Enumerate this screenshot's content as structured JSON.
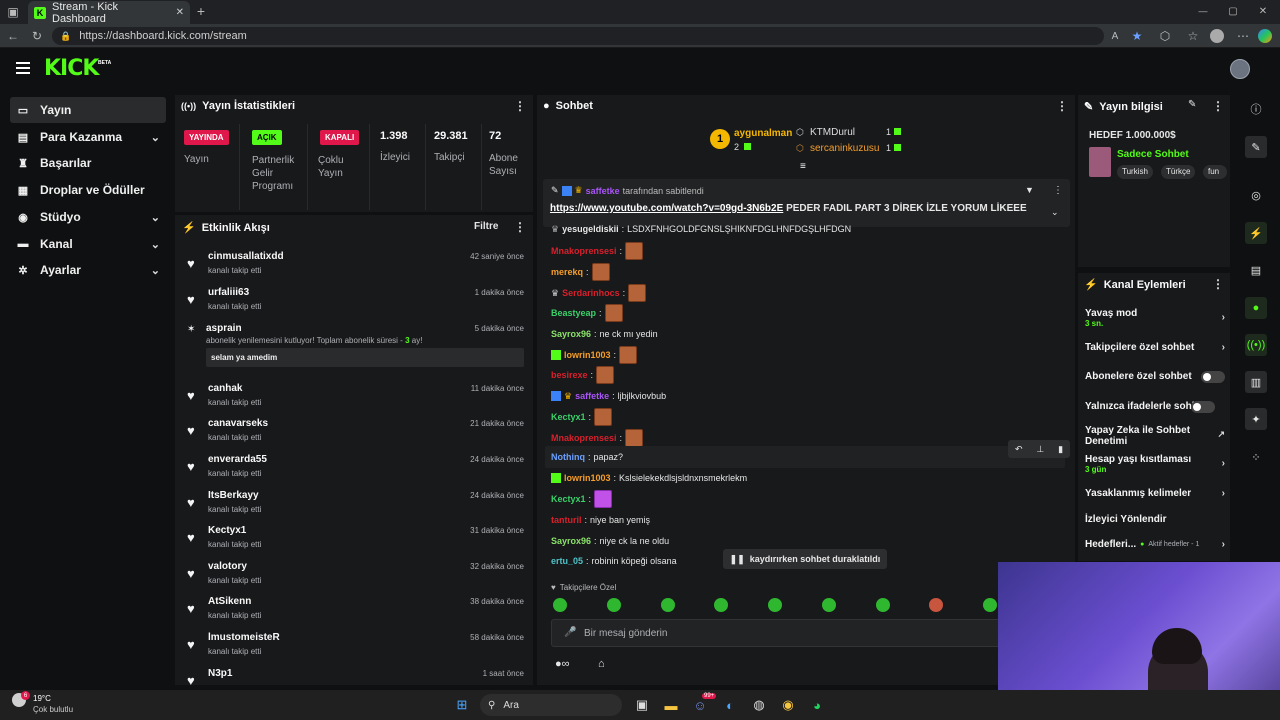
{
  "browser": {
    "tab_title": "Stream - Kick Dashboard",
    "url": "https://dashboard.kick.com/stream",
    "new_tab": "+",
    "minimize": "—",
    "maximize": "▢",
    "close": "✕"
  },
  "header": {
    "logo": "KICK",
    "beta": "BETA"
  },
  "sidebar": {
    "items": [
      {
        "label": "Yayın",
        "icon": "video-icon",
        "chevron": ""
      },
      {
        "label": "Para Kazanma",
        "icon": "money-icon",
        "chevron": "⌄"
      },
      {
        "label": "Başarılar",
        "icon": "trophy-icon",
        "chevron": ""
      },
      {
        "label": "Droplar ve Ödüller",
        "icon": "gift-icon",
        "chevron": ""
      },
      {
        "label": "Stüdyo",
        "icon": "studio-icon",
        "chevron": "⌄"
      },
      {
        "label": "Kanal",
        "icon": "channel-icon",
        "chevron": "⌄"
      },
      {
        "label": "Ayarlar",
        "icon": "gear-icon",
        "chevron": "⌄"
      }
    ]
  },
  "stats": {
    "title": "Yayın İstatistikleri",
    "items": [
      {
        "badge": "YAYINDA",
        "label": "Yayın",
        "color": "#e0174a",
        "text_color": "#ffffff"
      },
      {
        "badge": "AÇIK",
        "label": "Partnerlik Gelir Programı",
        "color": "#53fc18",
        "text_color": "#000000"
      },
      {
        "badge": "KAPALI",
        "label": "Çoklu Yayın",
        "color": "#e0174a",
        "text_color": "#ffffff"
      }
    ],
    "numbers": [
      {
        "value": "1.398",
        "label": "İzleyici"
      },
      {
        "value": "29.381",
        "label": "Takipçi"
      },
      {
        "value": "72",
        "label": "Abone Sayısı"
      }
    ]
  },
  "activity": {
    "title": "Etkinlik Akışı",
    "filter": "Filtre",
    "items": [
      {
        "name": "cinmusallatixdd",
        "sub": "kanalı takip etti",
        "time": "42 saniye önce"
      },
      {
        "name": "urfaliii63",
        "sub": "kanalı takip etti",
        "time": "1 dakika önce"
      },
      {
        "name": "asprain",
        "sub": "abonelik yenilemesini kutluyor! Toplam abonelik süresi -",
        "sub_count": "3",
        "sub_tail": "ay!",
        "message": "selam ya amedim",
        "time": "5 dakika önce"
      },
      {
        "name": "canhak",
        "sub": "kanalı takip etti",
        "time": "11 dakika önce"
      },
      {
        "name": "canavarseks",
        "sub": "kanalı takip etti",
        "time": "21 dakika önce"
      },
      {
        "name": "enverarda55",
        "sub": "kanalı takip etti",
        "time": "24 dakika önce"
      },
      {
        "name": "ItsBerkayy",
        "sub": "kanalı takip etti",
        "time": "24 dakika önce"
      },
      {
        "name": "Kectyx1",
        "sub": "kanalı takip etti",
        "time": "31 dakika önce"
      },
      {
        "name": "valotory",
        "sub": "kanalı takip etti",
        "time": "32 dakika önce"
      },
      {
        "name": "AtSikenn",
        "sub": "kanalı takip etti",
        "time": "38 dakika önce"
      },
      {
        "name": "lmustomeisteR",
        "sub": "kanalı takip etti",
        "time": "58 dakika önce"
      },
      {
        "name": "N3p1",
        "sub": "",
        "time": "1 saat önce"
      }
    ]
  },
  "chat": {
    "title": "Sohbet",
    "top_gifters": [
      {
        "rank": "1",
        "name": "aygunalman",
        "count": "2"
      },
      {
        "name": "KTMDurul",
        "count": "1"
      },
      {
        "name": "sercaninkuzusu",
        "count": "1"
      }
    ],
    "pinned": {
      "by_user": "saffetke",
      "by_text": "tarafından sabitlendi",
      "link": "https://www.youtube.com/watch?v=09gd-3N6b2E",
      "text": "PEDER FADIL PART 3 DİREK İZLE YORUM LİKEEE"
    },
    "messages": [
      {
        "user": "yesugeldiskii",
        "text": "LSDXFNHGOLDFGNSLŞHIKNFDGLHNFDGŞLHFDGN",
        "color": "#e8e8e8",
        "emote": false
      },
      {
        "user": "Mnakoprensesi",
        "text": "",
        "color": "#d8202c",
        "emote": true
      },
      {
        "user": "merekq",
        "text": "",
        "color": "#f59e2a",
        "emote": true
      },
      {
        "user": "Serdarinhocs",
        "text": "",
        "color": "#d8202c",
        "emote": true
      },
      {
        "user": "Beastyeap",
        "text": "",
        "color": "#3ad06a",
        "emote": true
      },
      {
        "user": "Sayrox96",
        "text": "ne ck mı yedin",
        "color": "#8be36a",
        "emote": false
      },
      {
        "user": "lowrin1003",
        "text": "",
        "color": "#f59e2a",
        "emote": true
      },
      {
        "user": "besirexe",
        "text": "",
        "color": "#d8202c",
        "emote": true
      },
      {
        "user": "saffetke",
        "text": "ljbjlkviovbub",
        "color": "#a855f7",
        "emote": false
      },
      {
        "user": "Kectyx1",
        "text": "",
        "color": "#3ad06a",
        "emote": true
      },
      {
        "user": "Mnakoprensesi",
        "text": "",
        "color": "#d8202c",
        "emote": true
      },
      {
        "user": "Nothinq",
        "text": "papaz?",
        "color": "#6aa0ff",
        "emote": false
      },
      {
        "user": "lowrin1003",
        "text": "Kslsielekekdlsjsldnxnsmekrlekm",
        "color": "#f59e2a",
        "emote": false
      },
      {
        "user": "Kectyx1",
        "text": "",
        "color": "#3ad06a",
        "emote": true
      },
      {
        "user": "tanturil",
        "text": "niye ban yemiş",
        "color": "#d8202c",
        "emote": false
      },
      {
        "user": "Sayrox96",
        "text": "niye ck la ne oldu",
        "color": "#8be36a",
        "emote": false
      },
      {
        "user": "ertu_05",
        "text": "robinin köpeği olsana",
        "color": "#4ec3c8",
        "emote": false
      }
    ],
    "paused": "kaydırırken sohbet duraklatıldı",
    "followers_only": "Takipçilere Özel",
    "input_placeholder": "Bir mesaj gönderin"
  },
  "stream_info": {
    "title": "Yayın bilgisi",
    "goal": "HEDEF 1.000.000$",
    "category": "Sadece Sohbet",
    "tags": [
      "Turkish",
      "Türkçe",
      "fun"
    ]
  },
  "channel_actions": {
    "title": "Kanal Eylemleri",
    "items": [
      {
        "label": "Yavaş mod",
        "sub": "3 sn.",
        "control": "arrow"
      },
      {
        "label": "Takipçilere özel sohbet",
        "sub": "",
        "control": "arrow"
      },
      {
        "label": "Abonelere özel sohbet",
        "sub": "",
        "control": "toggle"
      },
      {
        "label": "Yalnızca ifadelerle sohbet",
        "sub": "",
        "control": "toggle"
      },
      {
        "label": "Yapay Zeka ile Sohbet Denetimi",
        "sub": "",
        "control": "external"
      },
      {
        "label": "Hesap yaşı kısıtlaması",
        "sub": "3 gün",
        "control": "arrow"
      },
      {
        "label": "Yasaklanmış kelimeler",
        "sub": "",
        "control": "arrow"
      },
      {
        "label": "İzleyici Yönlendir",
        "sub": "",
        "control": "none"
      },
      {
        "label": "Hedefleri...",
        "sub": "Aktif hedefler - 1",
        "control": "arrow"
      }
    ]
  },
  "taskbar": {
    "weather_temp": "19°C",
    "weather_text": "Çok bulutlu",
    "search": "Ara",
    "notif_count": "6",
    "discord_badge": "99+"
  },
  "colors": {
    "kick_green": "#53fc18",
    "live_red": "#e0174a"
  }
}
